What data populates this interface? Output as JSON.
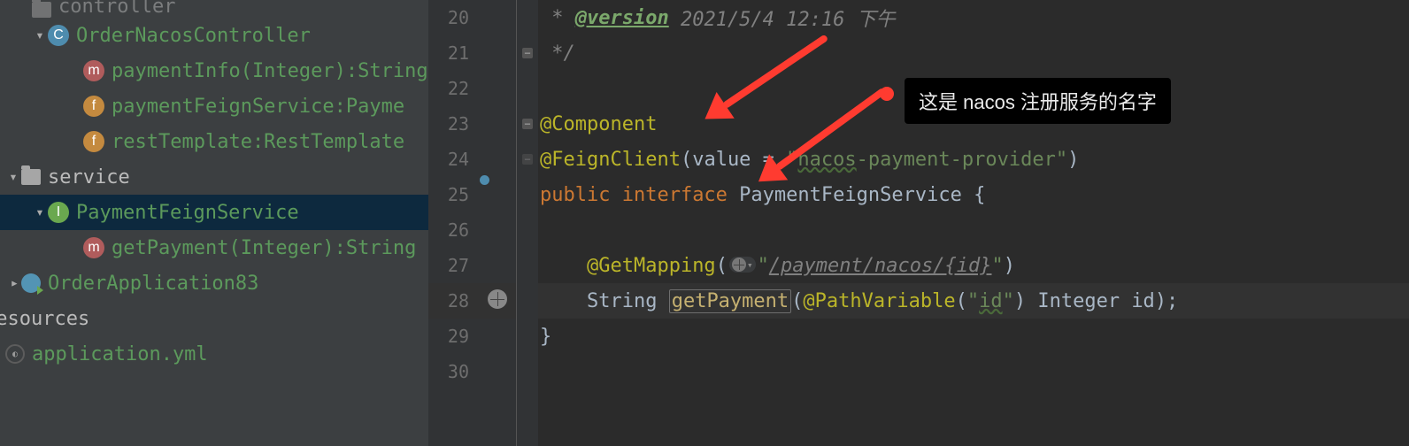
{
  "project_tree": {
    "top_cut_label": "controller",
    "items": [
      {
        "indent": 36,
        "chev": "down",
        "badge": "c-class",
        "badge_letter": "C",
        "label": "OrderNacosController",
        "green": true
      },
      {
        "indent": 94,
        "badge": "m-method",
        "badge_letter": "m",
        "label": "paymentInfo(Integer):String",
        "green": true
      },
      {
        "indent": 94,
        "badge": "f-field",
        "badge_letter": "f",
        "label": "paymentFeignService:Payme",
        "green": true
      },
      {
        "indent": 94,
        "badge": "f-field",
        "badge_letter": "f",
        "label": "restTemplate:RestTemplate",
        "green": true
      },
      {
        "indent": 6,
        "chev": "down",
        "folder": true,
        "label": "service"
      },
      {
        "indent": 36,
        "chev": "down",
        "badge": "i-interface",
        "badge_letter": "I",
        "label": "PaymentFeignService",
        "selected": true,
        "green": true
      },
      {
        "indent": 94,
        "badge": "m-method",
        "badge_letter": "m",
        "label": "getPayment(Integer):String",
        "green": true
      },
      {
        "indent": 6,
        "chev": "right",
        "run": true,
        "label": "OrderApplication83",
        "green": true
      },
      {
        "indent": -18,
        "label": "resources"
      },
      {
        "indent": 6,
        "yml": true,
        "label": "application.yml",
        "green": true
      }
    ]
  },
  "gutter": {
    "start": 20,
    "lines": [
      {
        "n": 20
      },
      {
        "n": 21
      },
      {
        "n": 22
      },
      {
        "n": 23,
        "icon": "spring"
      },
      {
        "n": 24
      },
      {
        "n": 25,
        "icon": "spring-blue"
      },
      {
        "n": 26
      },
      {
        "n": 27
      },
      {
        "n": 28,
        "icon": "globe",
        "hl": true
      },
      {
        "n": 29
      },
      {
        "n": 30
      }
    ]
  },
  "code": {
    "l20": {
      "version_tag": "@version",
      "version_text": " 2021/5/4 12:16 下午"
    },
    "l21": {
      "text": "*/"
    },
    "l23": {
      "anno": "@Component"
    },
    "l24": {
      "anno": "@FeignClient",
      "open": "(",
      "param": "value = ",
      "str": "\"",
      "str_val": "nacos",
      "str_rest": "-payment-provider\"",
      "close": ")"
    },
    "l25": {
      "kw1": "public ",
      "kw2": "interface ",
      "name": "PaymentFeignService ",
      "brace": "{"
    },
    "l27": {
      "anno": "@GetMapping",
      "open": "(",
      "str_pre": "\"",
      "path": "/payment/nacos/{id}",
      "str_post": "\"",
      "close": ")"
    },
    "l28": {
      "type": "String ",
      "method": "getPayment",
      "open": "(",
      "anno": "@PathVariable",
      "popen": "(",
      "pstr": "\"",
      "pval": "id",
      "pstr2": "\"",
      "pclose": ") ",
      "ptype": "Integer ",
      "pname": "id",
      "close": ");"
    },
    "l29": {
      "brace": "}"
    }
  },
  "annotation": {
    "tooltip": "这是 nacos 注册服务的名字"
  }
}
